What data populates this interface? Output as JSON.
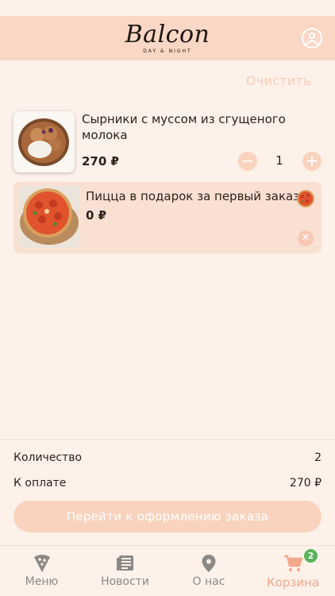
{
  "header": {
    "logo_text": "Balcon",
    "logo_tagline": "DAY & NIGHT"
  },
  "cart": {
    "clear_label": "Очистить",
    "items": [
      {
        "title": "Сырники с муссом из сгущеного молока",
        "price": "270 ₽",
        "quantity": "1"
      }
    ],
    "gift": {
      "title": "Пицца в подарок за первый заказ",
      "price": "0 ₽"
    }
  },
  "summary": {
    "count_label": "Количество",
    "count_value": "2",
    "total_label": "К оплате",
    "total_value": "270 ₽",
    "checkout_label": "Перейти к оформлению заказа"
  },
  "tabs": [
    {
      "label": "Меню",
      "icon": "pizza-slice-icon"
    },
    {
      "label": "Новости",
      "icon": "newspaper-icon"
    },
    {
      "label": "О нас",
      "icon": "map-pin-icon"
    },
    {
      "label": "Корзина",
      "icon": "cart-icon",
      "badge": "2"
    }
  ],
  "colors": {
    "background": "#fdf1ea",
    "header": "#f9d7c4",
    "accent": "#f9d3be",
    "active_tab": "#f2a98a",
    "badge": "#55b55a"
  }
}
